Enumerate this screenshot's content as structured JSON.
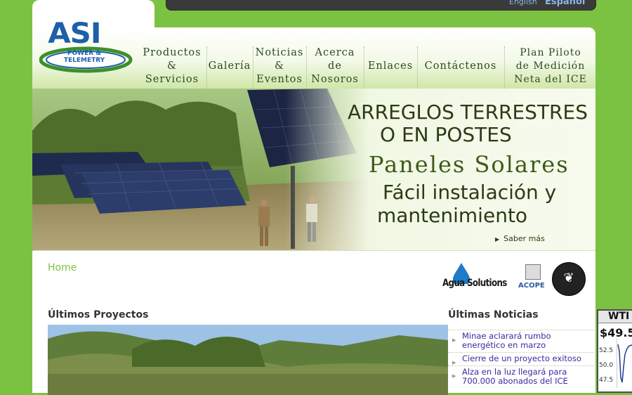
{
  "lang": {
    "english": "English",
    "spanish": "Español"
  },
  "logo": {
    "main": "ASI",
    "sub1": "POWER &",
    "sub2": "TELEMETRY"
  },
  "nav": [
    {
      "label": "Productos\n&\nServicios"
    },
    {
      "label": "Galería"
    },
    {
      "label": "Noticias\n&\nEventos"
    },
    {
      "label": "Acerca\nde\nNosoros"
    },
    {
      "label": "Enlaces"
    },
    {
      "label": "Contáctenos"
    },
    {
      "label": "Plan Piloto\nde Medición\nNeta del ICE"
    }
  ],
  "banner": {
    "line1": "ARREGLOS TERRESTRES",
    "line2": "O EN POSTES",
    "line3": "Paneles Solares",
    "line4": "Fácil instalación y",
    "line5": "mantenimiento",
    "cta": "Saber más"
  },
  "breadcrumb": "Home",
  "partners": {
    "agua": "Agua Solutions",
    "acope": "ACOPE"
  },
  "projects": {
    "title": "Últimos Proyectos"
  },
  "news": {
    "title": "Últimas Noticias",
    "items": [
      "Minae aclarará rumbo energético en marzo",
      "Cierre de un proyecto exitoso",
      "Alza en la luz llegará para 700.000 abonados del ICE"
    ]
  },
  "wti": {
    "label": "WTI",
    "price": "$49.5",
    "ticks": [
      "52.5",
      "50.0",
      "47.5"
    ]
  },
  "colors": {
    "page_bg": "#7cc242",
    "link": "#3a2aa0",
    "nav_text": "#2a4b1b"
  }
}
